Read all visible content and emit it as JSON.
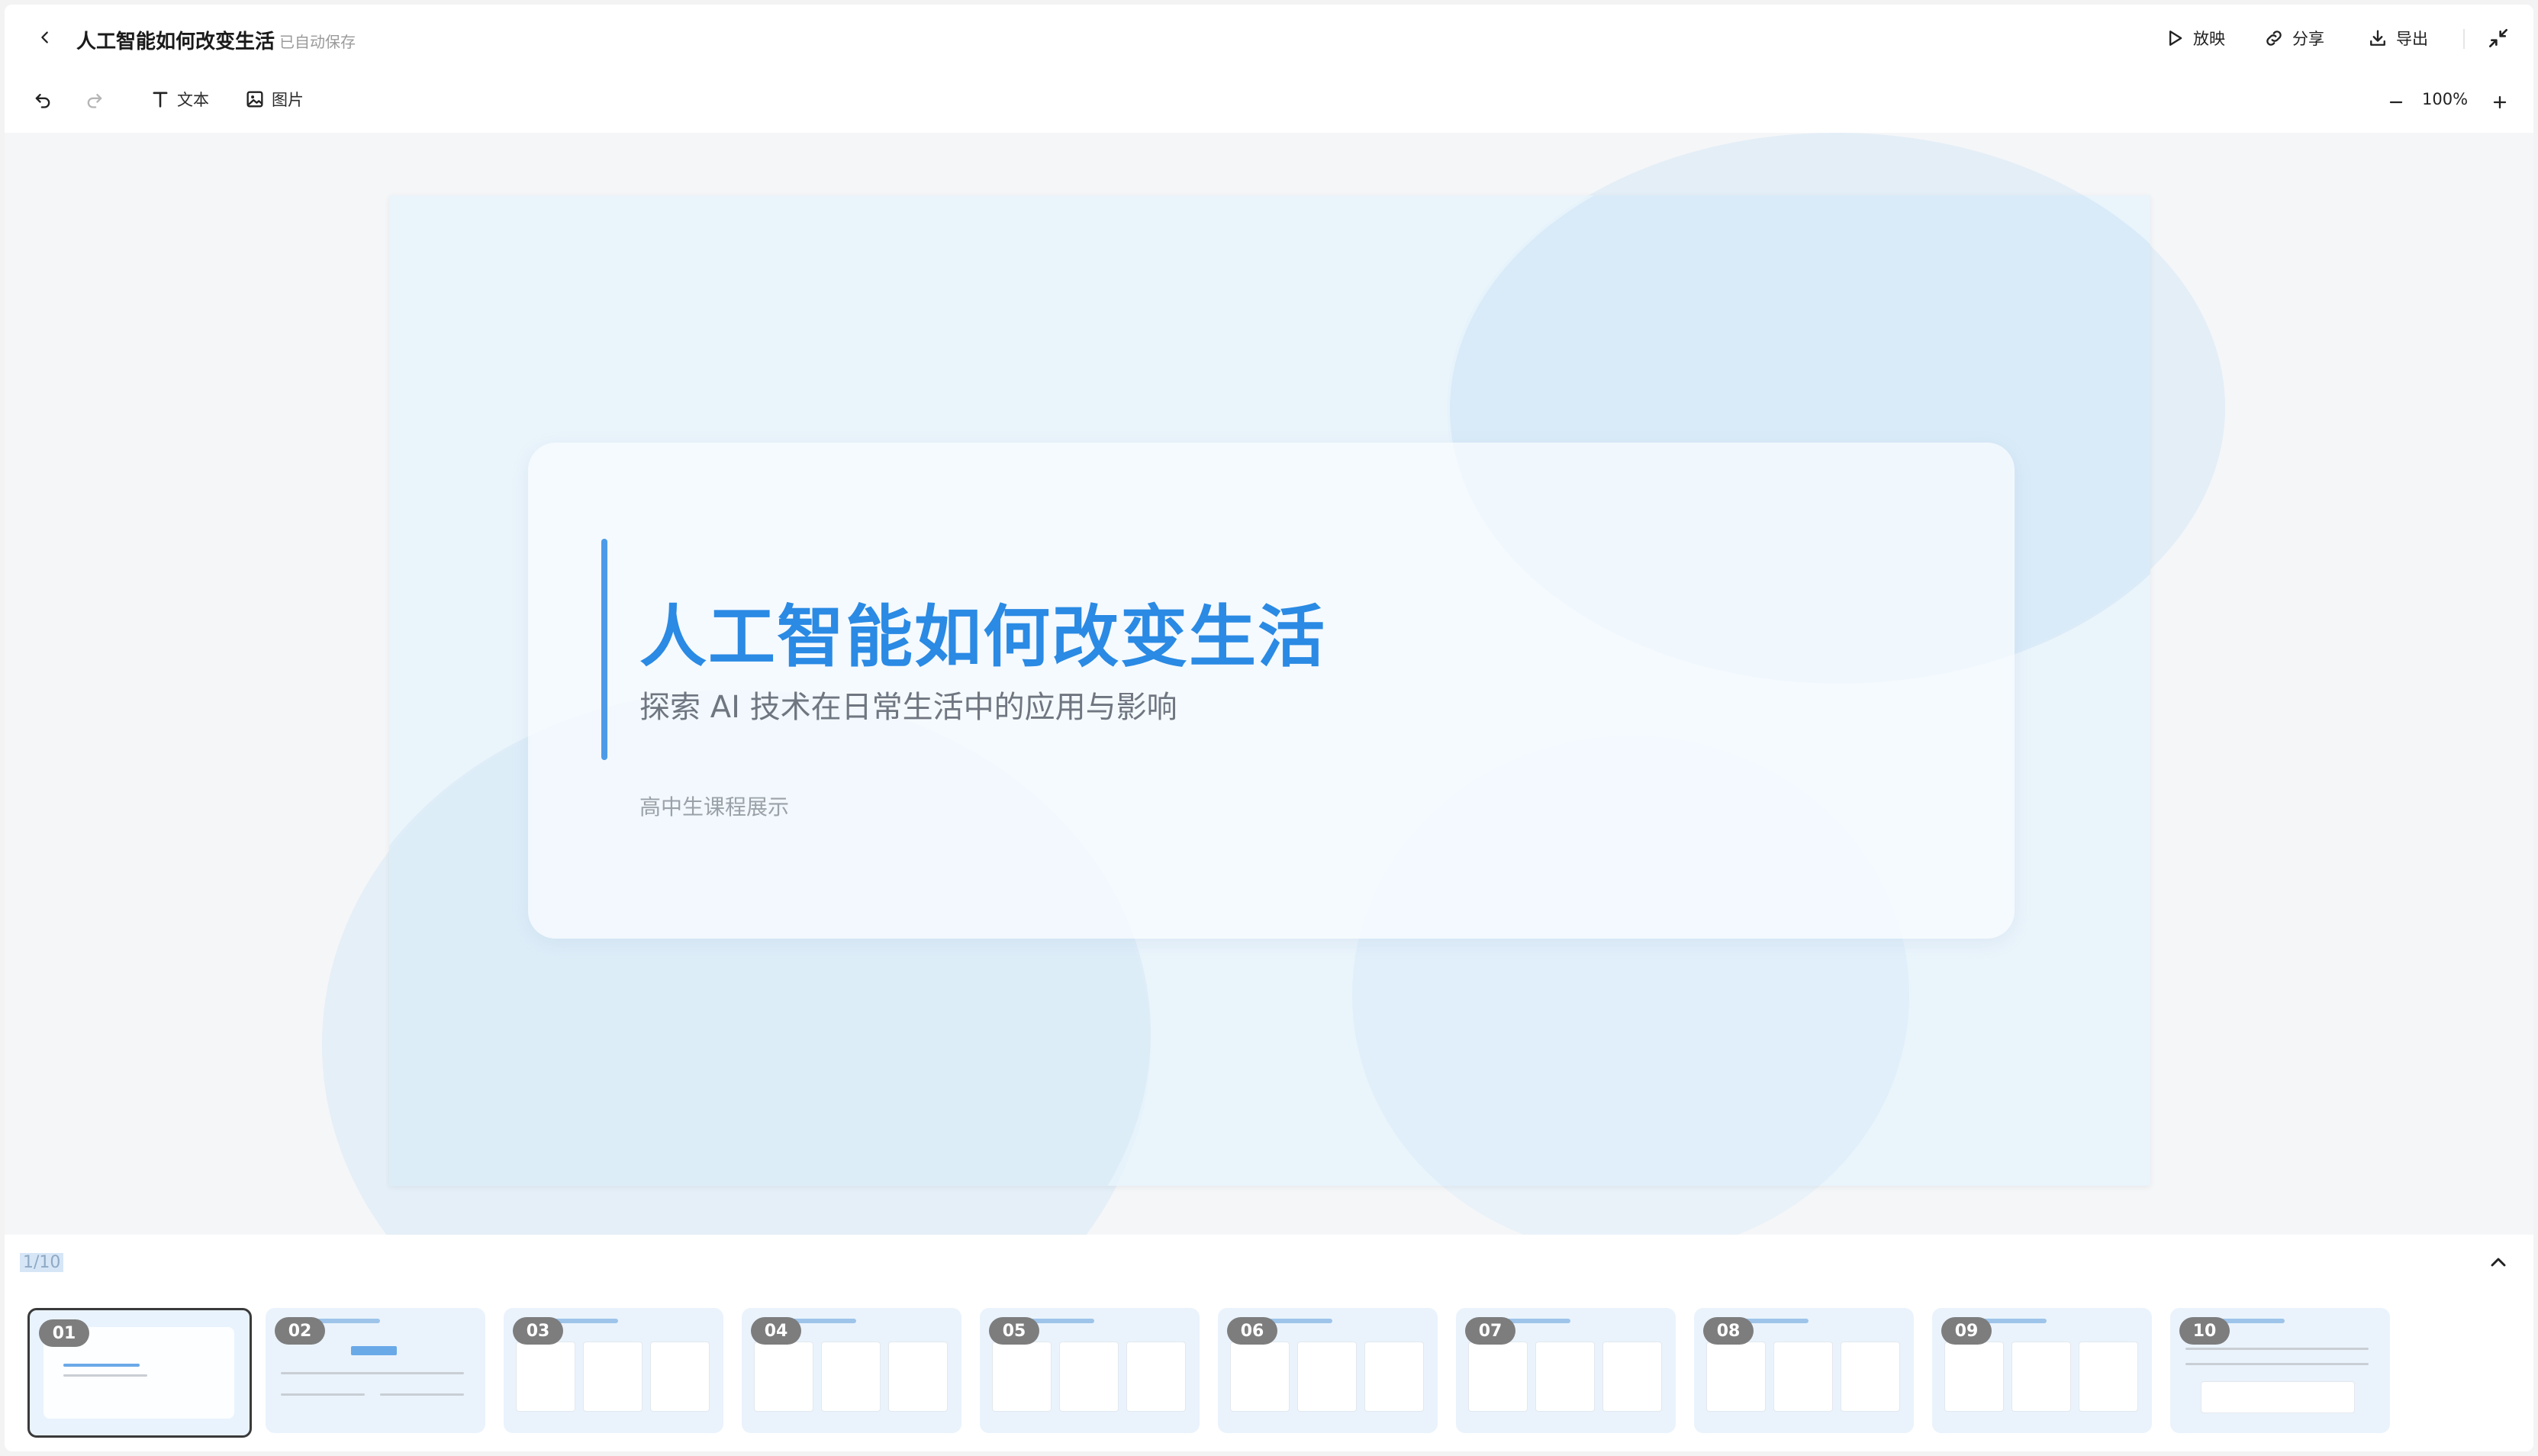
{
  "header": {
    "back_icon": "chevron-left-icon",
    "title": "人工智能如何改变生活",
    "save_status": "已自动保存",
    "present_label": "放映",
    "share_label": "分享",
    "export_label": "导出"
  },
  "toolbar": {
    "text_label": "文本",
    "image_label": "图片",
    "zoom_level": "100%"
  },
  "slide": {
    "title": "人工智能如何改变生活",
    "subtitle": "探索 AI 技术在日常生活中的应用与影响",
    "meta": "高中生课程展示"
  },
  "filmstrip": {
    "page_counter": "1/10",
    "current_index": 1,
    "thumbnails": [
      {
        "num": "01"
      },
      {
        "num": "02"
      },
      {
        "num": "03"
      },
      {
        "num": "04"
      },
      {
        "num": "05"
      },
      {
        "num": "06"
      },
      {
        "num": "07"
      },
      {
        "num": "08"
      },
      {
        "num": "09"
      },
      {
        "num": "10"
      }
    ]
  },
  "colors": {
    "accent": "#2a8ae4",
    "accent_bar": "#4d9be8",
    "thumb_badge": "#7d7d7d"
  }
}
